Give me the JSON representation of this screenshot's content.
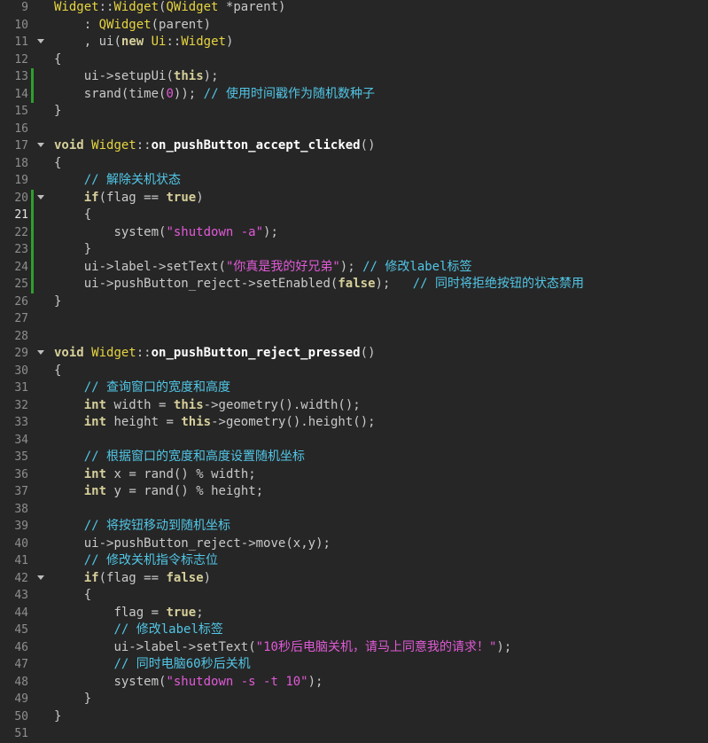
{
  "editor": {
    "lines": [
      {
        "n": "9",
        "code": "Widget::Widget(QWidget *parent)"
      },
      {
        "n": "10",
        "code": "    : QWidget(parent)"
      },
      {
        "n": "11",
        "code": "    , ui(new Ui::Widget)"
      },
      {
        "n": "12",
        "code": "{"
      },
      {
        "n": "13",
        "code": "    ui->setupUi(this);"
      },
      {
        "n": "14",
        "code": "    srand(time(0)); // 使用时间戳作为随机数种子"
      },
      {
        "n": "15",
        "code": "}"
      },
      {
        "n": "16",
        "code": ""
      },
      {
        "n": "17",
        "code": "void Widget::on_pushButton_accept_clicked()"
      },
      {
        "n": "18",
        "code": "{"
      },
      {
        "n": "19",
        "code": "    // 解除关机状态"
      },
      {
        "n": "20",
        "code": "    if(flag == true)"
      },
      {
        "n": "21",
        "code": "    {"
      },
      {
        "n": "22",
        "code": "        system(\"shutdown -a\");"
      },
      {
        "n": "23",
        "code": "    }"
      },
      {
        "n": "24",
        "code": "    ui->label->setText(\"你真是我的好兄弟\"); // 修改label标签"
      },
      {
        "n": "25",
        "code": "    ui->pushButton_reject->setEnabled(false);   // 同时将拒绝按钮的状态禁用"
      },
      {
        "n": "26",
        "code": "}"
      },
      {
        "n": "27",
        "code": ""
      },
      {
        "n": "28",
        "code": ""
      },
      {
        "n": "29",
        "code": "void Widget::on_pushButton_reject_pressed()"
      },
      {
        "n": "30",
        "code": "{"
      },
      {
        "n": "31",
        "code": "    // 查询窗口的宽度和高度"
      },
      {
        "n": "32",
        "code": "    int width = this->geometry().width();"
      },
      {
        "n": "33",
        "code": "    int height = this->geometry().height();"
      },
      {
        "n": "34",
        "code": ""
      },
      {
        "n": "35",
        "code": "    // 根据窗口的宽度和高度设置随机坐标"
      },
      {
        "n": "36",
        "code": "    int x = rand() % width;"
      },
      {
        "n": "37",
        "code": "    int y = rand() % height;"
      },
      {
        "n": "38",
        "code": ""
      },
      {
        "n": "39",
        "code": "    // 将按钮移动到随机坐标"
      },
      {
        "n": "40",
        "code": "    ui->pushButton_reject->move(x,y);"
      },
      {
        "n": "41",
        "code": "    // 修改关机指令标志位"
      },
      {
        "n": "42",
        "code": "    if(flag == false)"
      },
      {
        "n": "43",
        "code": "    {"
      },
      {
        "n": "44",
        "code": "        flag = true;"
      },
      {
        "n": "45",
        "code": "        // 修改label标签"
      },
      {
        "n": "46",
        "code": "        ui->label->setText(\"10秒后电脑关机，请马上同意我的请求！\");"
      },
      {
        "n": "47",
        "code": "        // 同时电脑60秒后关机"
      },
      {
        "n": "48",
        "code": "        system(\"shutdown -s -t 10\");"
      },
      {
        "n": "49",
        "code": "    }"
      },
      {
        "n": "50",
        "code": "}"
      },
      {
        "n": "51",
        "code": ""
      }
    ],
    "current_line": "21",
    "colors": {
      "background": "#262626",
      "line_number": "#8e8e8e",
      "modified_marker": "#2e9e2e",
      "comment": "#51c6e6",
      "string": "#e05ad7",
      "class": "#e6d440"
    },
    "icons": {
      "fold": "chevron-down-icon"
    }
  }
}
